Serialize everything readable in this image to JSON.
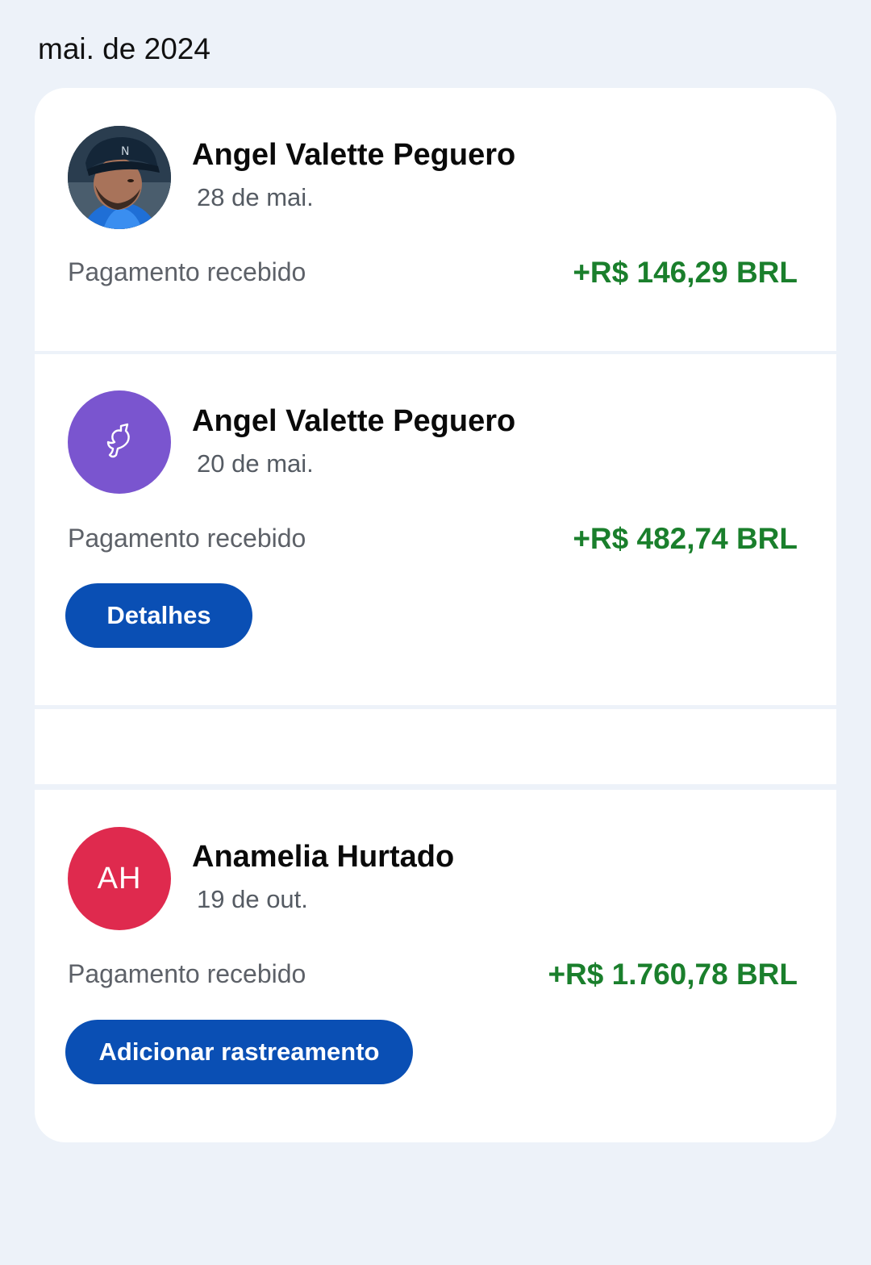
{
  "month_header": "mai. de 2024",
  "colors": {
    "background": "#edf2f9",
    "amount_positive": "#1a7f2c",
    "button_primary": "#0a4fb4",
    "avatar_purple": "#7a55cf",
    "avatar_initials_bg": "#df2a4e"
  },
  "transactions": [
    {
      "name": "Angel Valette Peguero",
      "date": "28 de mai.",
      "status": "Pagamento recebido",
      "amount": "+R$ 146,29 BRL",
      "avatar": "photo"
    },
    {
      "name": "Angel Valette Peguero",
      "date": "20 de mai.",
      "status": "Pagamento recebido",
      "amount": "+R$ 482,74 BRL",
      "avatar": "bird-icon",
      "button_label": "Detalhes"
    },
    {
      "name": "Anamelia Hurtado",
      "date": "19 de out.",
      "status": "Pagamento recebido",
      "amount": "+R$ 1.760,78 BRL",
      "avatar_initials": "AH",
      "button_label": "Adicionar rastreamento"
    }
  ]
}
